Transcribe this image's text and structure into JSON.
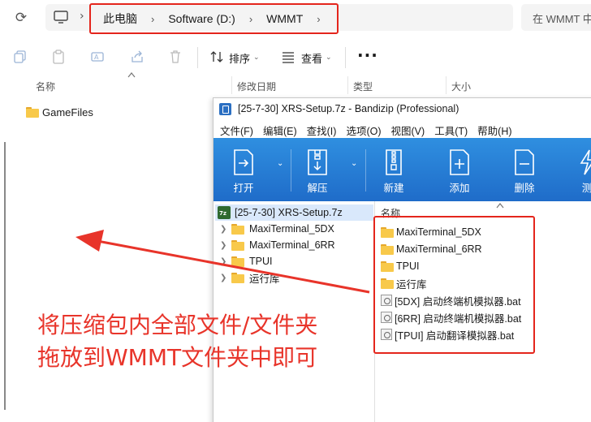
{
  "explorer": {
    "breadcrumb": [
      "此电脑",
      "Software (D:)",
      "WMMT"
    ],
    "search_placeholder": "在 WMMT 中",
    "toolbar": {
      "sort_label": "排序",
      "view_label": "查看"
    },
    "columns": [
      "名称",
      "修改日期",
      "类型",
      "大小"
    ],
    "files": [
      {
        "name": "GameFiles",
        "icon": "folder-icon"
      }
    ]
  },
  "bandizip": {
    "title": "[25-7-30] XRS-Setup.7z - Bandizip (Professional)",
    "menu": [
      "文件(F)",
      "编辑(E)",
      "查找(I)",
      "选项(O)",
      "视图(V)",
      "工具(T)",
      "帮助(H)"
    ],
    "ribbon": [
      "打开",
      "解压",
      "新建",
      "添加",
      "删除",
      "测"
    ],
    "tree_root": "[25-7-30] XRS-Setup.7z",
    "tree_items": [
      "MaxiTerminal_5DX",
      "MaxiTerminal_6RR",
      "TPUI",
      "运行库"
    ],
    "list_header": "名称",
    "list_items": [
      {
        "name": "MaxiTerminal_5DX",
        "icon": "folder-icon"
      },
      {
        "name": "MaxiTerminal_6RR",
        "icon": "folder-icon"
      },
      {
        "name": "TPUI",
        "icon": "folder-icon"
      },
      {
        "name": "运行库",
        "icon": "folder-icon"
      },
      {
        "name": "[5DX] 启动终端机模拟器.bat",
        "icon": "batch-file-icon"
      },
      {
        "name": "[6RR] 启动终端机模拟器.bat",
        "icon": "batch-file-icon"
      },
      {
        "name": "[TPUI] 启动翻译模拟器.bat",
        "icon": "batch-file-icon"
      }
    ]
  },
  "annotation": {
    "line1": "将压缩包内全部文件/文件夹",
    "line2": "拖放到WMMT文件夹中即可",
    "color": "#e8342a"
  }
}
